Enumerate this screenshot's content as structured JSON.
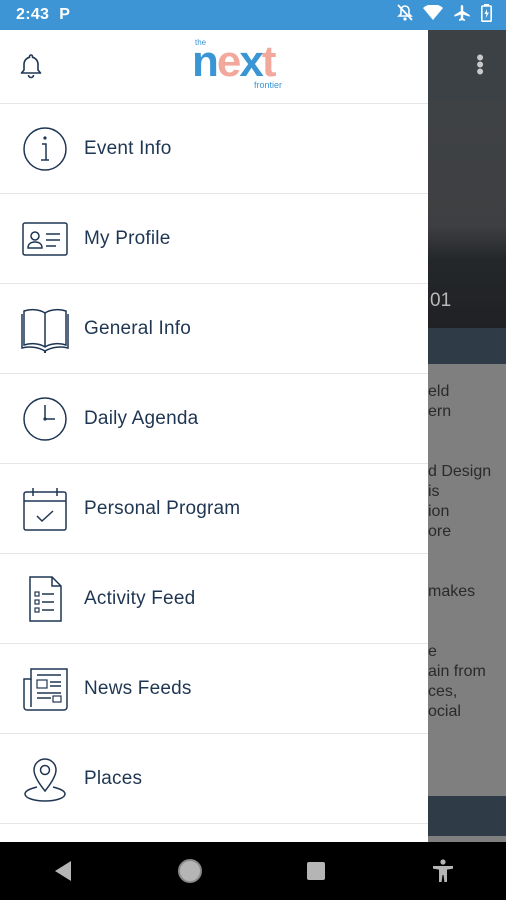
{
  "status_bar": {
    "time": "2:43",
    "notification_badge": "P",
    "icons": [
      "bell-off-icon",
      "wifi-icon",
      "airplane-icon",
      "battery-icon"
    ]
  },
  "logo": {
    "the": "the",
    "word_n": "n",
    "word_e": "e",
    "word_x": "x",
    "word_t": "t",
    "tagline": "frontier"
  },
  "drawer": {
    "items": [
      {
        "label": "Event Info",
        "icon": "info-icon"
      },
      {
        "label": "My Profile",
        "icon": "id-card-icon"
      },
      {
        "label": "General Info",
        "icon": "book-icon"
      },
      {
        "label": "Daily Agenda",
        "icon": "clock-icon"
      },
      {
        "label": "Personal Program",
        "icon": "calendar-check-icon"
      },
      {
        "label": "Activity Feed",
        "icon": "checklist-document-icon"
      },
      {
        "label": "News Feeds",
        "icon": "newspaper-icon"
      },
      {
        "label": "Places",
        "icon": "map-pin-icon"
      }
    ]
  },
  "background": {
    "hero_fragment": "01",
    "paragraphs": [
      "eld\nern",
      "d Design\nis\nion\nore",
      "makes",
      "e\nain from\nces,\nocial"
    ]
  },
  "colors": {
    "status_bar": "#3d95d6",
    "menu_text": "#1f3653",
    "icon_stroke": "#1f3653",
    "logo_blue": "#3a95d5",
    "logo_peach": "#f2a99c"
  }
}
